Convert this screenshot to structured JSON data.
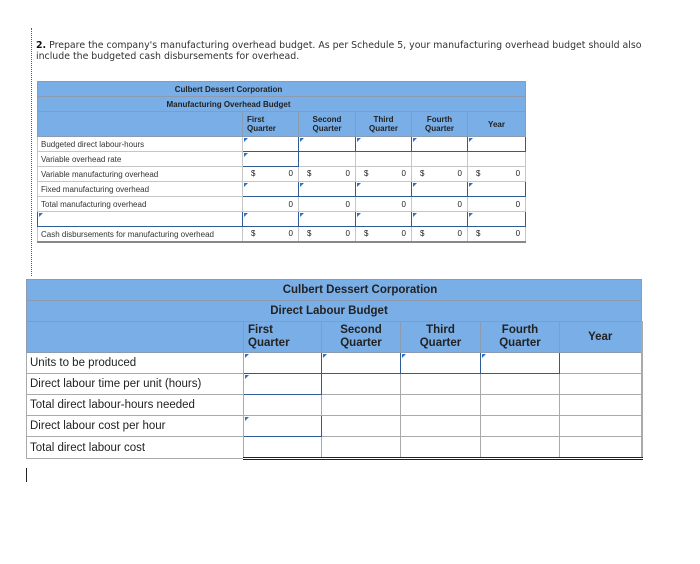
{
  "question": {
    "number": "2.",
    "text": "Prepare the company's manufacturing overhead budget. As per Schedule 5, your manufacturing overhead budget should also include the budgeted cash disbursements for overhead."
  },
  "overhead_budget": {
    "company": "Culbert Dessert Corporation",
    "title": "Manufacturing Overhead Budget",
    "columns": [
      {
        "line1": "First",
        "line2": "Quarter"
      },
      {
        "line1": "Second",
        "line2": "Quarter"
      },
      {
        "line1": "Third",
        "line2": "Quarter"
      },
      {
        "line1": "Fourth",
        "line2": "Quarter"
      },
      {
        "line1": "Year",
        "line2": ""
      }
    ],
    "rows": {
      "budgeted_dlh": {
        "label": "Budgeted direct labour-hours",
        "values": [
          "",
          "",
          "",
          "",
          ""
        ]
      },
      "variable_rate": {
        "label": "Variable overhead rate",
        "values": [
          "",
          "",
          "",
          "",
          ""
        ]
      },
      "variable_moh": {
        "label": "Variable manufacturing overhead",
        "currency": "$",
        "values": [
          "0",
          "0",
          "0",
          "0",
          "0"
        ]
      },
      "fixed_moh": {
        "label": "Fixed manufacturing overhead",
        "values": [
          "",
          "",
          "",
          "",
          ""
        ]
      },
      "total_moh": {
        "label": "Total manufacturing overhead",
        "values": [
          "0",
          "0",
          "0",
          "0",
          "0"
        ]
      },
      "adjustment": {
        "label": "",
        "values": [
          "",
          "",
          "",
          "",
          ""
        ]
      },
      "cash_disbursements": {
        "label": "Cash disbursements for manufacturing overhead",
        "currency": "$",
        "values": [
          "0",
          "0",
          "0",
          "0",
          "0"
        ]
      }
    }
  },
  "labour_budget": {
    "company": "Culbert Dessert Corporation",
    "title": "Direct Labour Budget",
    "columns": [
      {
        "line1": "First",
        "line2": "Quarter"
      },
      {
        "line1": "Second",
        "line2": "Quarter"
      },
      {
        "line1": "Third",
        "line2": "Quarter"
      },
      {
        "line1": "Fourth",
        "line2": "Quarter"
      },
      {
        "line1": "Year",
        "line2": ""
      }
    ],
    "rows": [
      {
        "label": "Units to be produced",
        "values": [
          "",
          "",
          "",
          "",
          ""
        ]
      },
      {
        "label": "Direct labour time per unit (hours)",
        "values": [
          "",
          "",
          "",
          "",
          ""
        ]
      },
      {
        "label": "Total direct labour-hours needed",
        "values": [
          "",
          "",
          "",
          "",
          ""
        ]
      },
      {
        "label": "Direct labour cost per hour",
        "values": [
          "",
          "",
          "",
          "",
          ""
        ]
      },
      {
        "label": "Total direct labour cost",
        "values": [
          "",
          "",
          "",
          "",
          ""
        ]
      }
    ]
  },
  "colors": {
    "header_bg": "#7aaee6",
    "input_border": "#2f5c94",
    "input_flag": "#2f6fc6"
  }
}
